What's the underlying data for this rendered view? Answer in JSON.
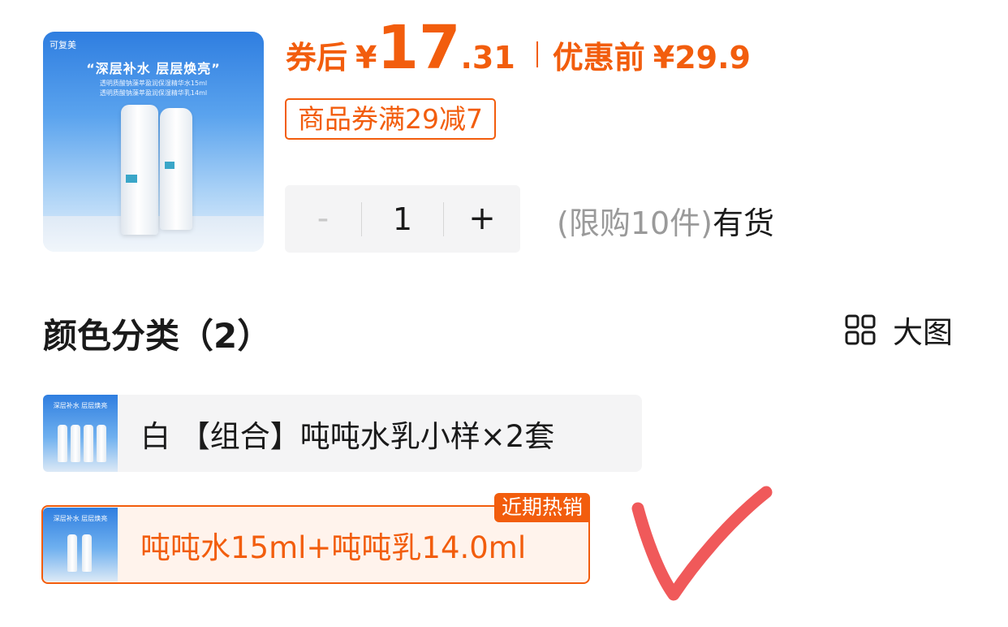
{
  "product": {
    "brand": "可复美",
    "slogan": "“深层补水 层层焕亮”",
    "lines": [
      "透明质酸钠藻萃盈润保湿精华水15ml",
      "透明质酸钠藻萃盈润保湿精华乳14ml"
    ]
  },
  "price": {
    "coupon_label": "券后",
    "currency": "¥",
    "integer": "17",
    "decimal": ".31",
    "original_label": "优惠前",
    "original_price": "¥29.9"
  },
  "coupon": {
    "text": "商品券满29减7"
  },
  "quantity": {
    "minus": "-",
    "value": "1",
    "plus": "+",
    "limit": "(限购10件)",
    "stock": "有货"
  },
  "section": {
    "title": "颜色分类（2）",
    "view_toggle_icon": "grid-icon",
    "view_toggle_label": "大图"
  },
  "options": [
    {
      "label": "白 【组合】吨吨水乳小样×2套",
      "selected": false,
      "badge": ""
    },
    {
      "label": "吨吨水15ml+吨吨乳14.0ml",
      "selected": true,
      "badge": "近期热销"
    }
  ],
  "thumb": {
    "mini_slogan": "深层补水 层层焕亮"
  },
  "colors": {
    "accent": "#f25d0d",
    "selected_bg": "#fff3ec",
    "option_bg": "#f4f4f5",
    "annotation": "#f0595a"
  }
}
